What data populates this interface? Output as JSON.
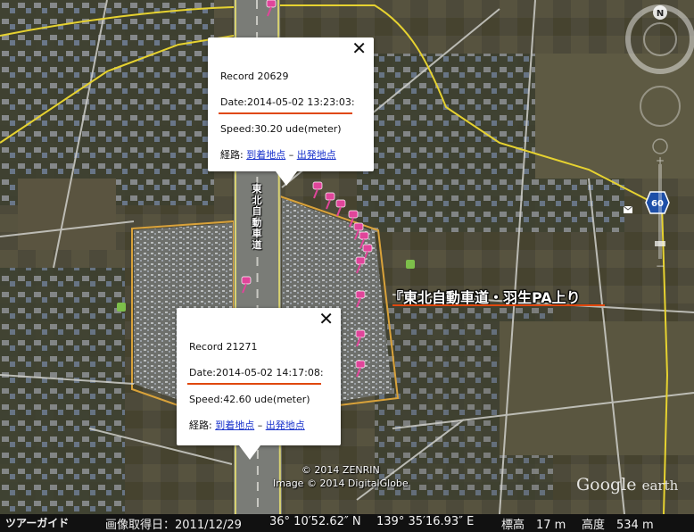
{
  "map": {
    "type": "satellite",
    "highway_label": "東北自動車道",
    "pa_label": "『東北自動車道・羽生PA上り",
    "route_number": "60",
    "compass_letter": "N",
    "copyright_lines": [
      "© 2014 ZENRIN",
      "Image © 2014 DigitalGlobe"
    ],
    "logo_google": "Google",
    "logo_earth": "earth"
  },
  "popups": [
    {
      "record": "Record 20629",
      "date": "Date:2014-05-02 13:23:03:",
      "speed": "Speed:30.20 ude(meter)",
      "route_prefix": "経路: ",
      "link_arrive": "到着地点",
      "separator": " – ",
      "link_depart": "出発地点",
      "close": "✕"
    },
    {
      "record": "Record 21271",
      "date": "Date:2014-05-02 14:17:08:",
      "speed": "Speed:42.60 ude(meter)",
      "route_prefix": "経路: ",
      "link_arrive": "到着地点",
      "separator": " – ",
      "link_depart": "出発地点",
      "close": "✕"
    }
  ],
  "status_bar": {
    "tour_guide": "ツアーガイド",
    "imagery_date": "画像取得日：2011/12/29",
    "lat": "36° 10′52.62″ N",
    "lon": "139° 35′16.93″ E",
    "elevation": "標高　17 m",
    "eye_alt": "高度　534 m"
  },
  "colors": {
    "pin": "#e0459a",
    "annotation_underline": "#e0480e",
    "road_yellow": "#e6d230",
    "pa_outline": "#d9a23a"
  }
}
